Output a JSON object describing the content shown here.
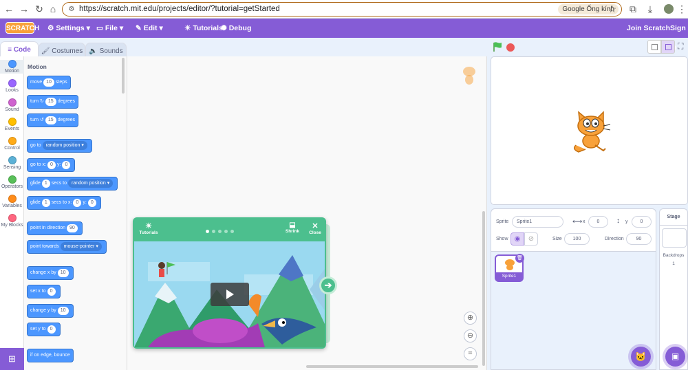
{
  "browser": {
    "url": "https://scratch.mit.edu/projects/editor/?tutorial=getStarted",
    "lens_label": "Google Ống kính"
  },
  "menubar": {
    "logo": "SCRATCH",
    "settings": "Settings",
    "file": "File",
    "edit": "Edit",
    "tutorials": "Tutorials",
    "debug": "Debug",
    "join": "Join Scratch",
    "signin": "Sign in"
  },
  "tabs": {
    "code": "Code",
    "costumes": "Costumes",
    "sounds": "Sounds"
  },
  "categories": [
    {
      "label": "Motion",
      "color": "#4c97ff"
    },
    {
      "label": "Looks",
      "color": "#9966ff"
    },
    {
      "label": "Sound",
      "color": "#cf63cf"
    },
    {
      "label": "Events",
      "color": "#ffbf00"
    },
    {
      "label": "Control",
      "color": "#ffab19"
    },
    {
      "label": "Sensing",
      "color": "#5cb1d6"
    },
    {
      "label": "Operators",
      "color": "#59c059"
    },
    {
      "label": "Variables",
      "color": "#ff8c1a"
    },
    {
      "label": "My Blocks",
      "color": "#ff6680"
    }
  ],
  "palette": {
    "heading": "Motion",
    "move": {
      "a": "move",
      "v": "10",
      "b": "steps"
    },
    "turn_r": {
      "a": "turn",
      "v": "15",
      "b": "degrees"
    },
    "turn_l": {
      "a": "turn",
      "v": "15",
      "b": "degrees"
    },
    "goto": {
      "a": "go to",
      "dd": "random position"
    },
    "gotoxy": {
      "a": "go to x:",
      "x": "0",
      "b": "y:",
      "y": "0"
    },
    "glide": {
      "a": "glide",
      "v": "1",
      "b": "secs to",
      "dd": "random position"
    },
    "glidexy": {
      "a": "glide",
      "v": "1",
      "b": "secs to x:",
      "x": "0",
      "c": "y:",
      "y": "0"
    },
    "point": {
      "a": "point in direction",
      "v": "90"
    },
    "towards": {
      "a": "point towards",
      "dd": "mouse-pointer"
    },
    "changex": {
      "a": "change x by",
      "v": "10"
    },
    "setx": {
      "a": "set x to",
      "v": "0"
    },
    "changey": {
      "a": "change y by",
      "v": "10"
    },
    "sety": {
      "a": "set y to",
      "v": "0"
    },
    "bounce": {
      "a": "if on edge, bounce"
    }
  },
  "tutorial": {
    "label": "Tutorials",
    "shrink": "Shrink",
    "close": "Close"
  },
  "sprite": {
    "label": "Sprite",
    "name": "Sprite1",
    "x_label": "x",
    "x": "0",
    "y_label": "y",
    "y": "0",
    "show": "Show",
    "size_label": "Size",
    "size": "100",
    "direction_label": "Direction",
    "direction": "90",
    "tile_name": "Sprite1"
  },
  "stage_pane": {
    "title": "Stage",
    "backdrops_label": "Backdrops",
    "backdrops": "1"
  }
}
